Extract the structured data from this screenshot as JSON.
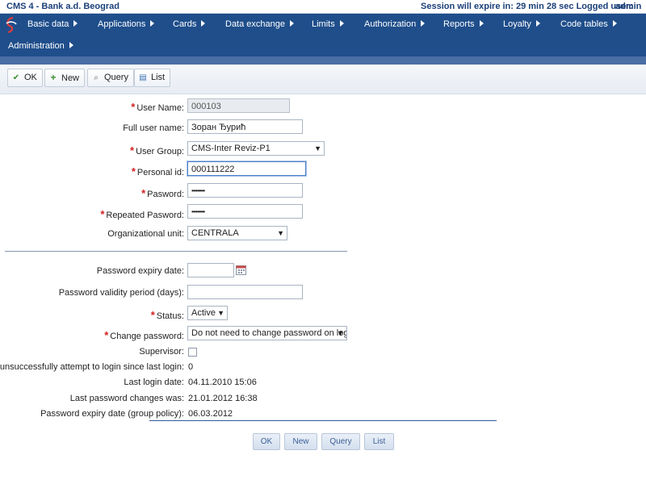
{
  "titlebar": {
    "app_title": "CMS  4 - Bank a.d. Beograd",
    "session_text": "Session will expire in: 29 min 28 sec  Logged user:",
    "user": "admin"
  },
  "nav": {
    "items": [
      "Basic data",
      "Applications",
      "Cards",
      "Data exchange",
      "Limits",
      "Authorization",
      "Reports",
      "Loyalty",
      "Code tables",
      "Administration"
    ]
  },
  "toolbar": {
    "ok": "OK",
    "new": "New",
    "query": "Query",
    "list": "List"
  },
  "form": {
    "user_name": {
      "label": "User Name:",
      "value": "000103"
    },
    "full_user_name": {
      "label": "Full user name:",
      "value": "Зоран Ђурић"
    },
    "user_group": {
      "label": "User Group:",
      "value": "CMS-Inter Reviz-P1"
    },
    "personal_id": {
      "label": "Personal id:",
      "value": "000111222"
    },
    "password": {
      "label": "Pasword:",
      "value": "•••••••••"
    },
    "repeated_password": {
      "label": "Repeated Pasword:",
      "value": "•••••••••"
    },
    "org_unit": {
      "label": "Organizational unit:",
      "value": "CENTRALA"
    },
    "pwd_expiry": {
      "label": "Password expiry date:",
      "value": ""
    },
    "pwd_validity": {
      "label": "Password validity period (days):",
      "value": ""
    },
    "status": {
      "label": "Status:",
      "value": "Active"
    },
    "change_password": {
      "label": "Change password:",
      "value": "Do not need to change password on login"
    },
    "supervisor": {
      "label": "Supervisor:",
      "checked": false
    },
    "unsuccessful": {
      "label": "No. of unsuccessfully attempt to login since last login:",
      "value": "0"
    },
    "last_login": {
      "label": "Last login date:",
      "value": "04.11.2010 15:06"
    },
    "last_pwd_change": {
      "label": "Last password changes was:",
      "value": "21.01.2012 16:38"
    },
    "pwd_expiry_group": {
      "label": "Password expiry date (group policy):",
      "value": "06.03.2012"
    }
  },
  "bottom": {
    "ok": "OK",
    "new": "New",
    "query": "Query",
    "list": "List"
  },
  "colors": {
    "nav_bg": "#1f4e8b",
    "required": "#d21f1f",
    "title_text": "#1b3f78"
  }
}
